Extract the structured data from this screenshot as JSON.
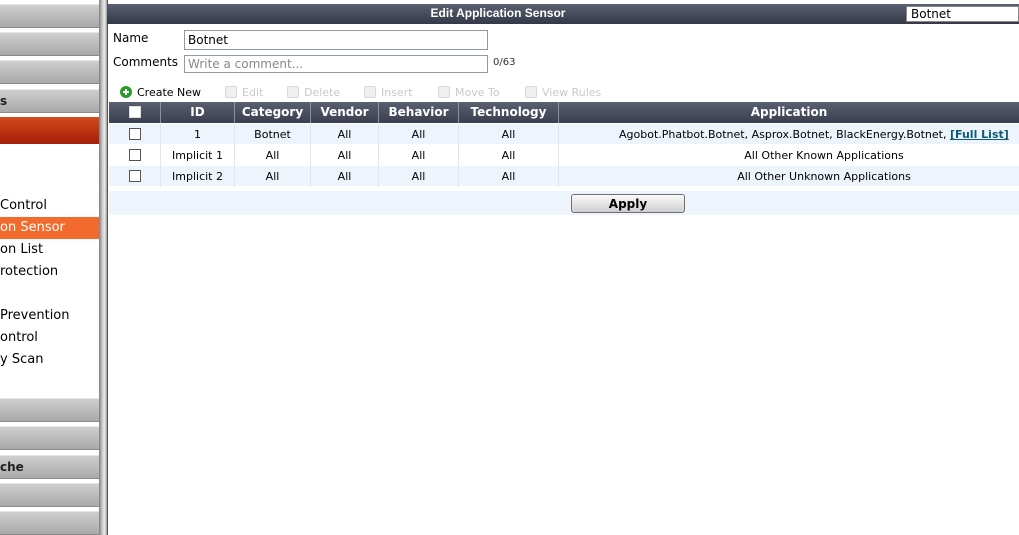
{
  "sidebar": {
    "section_label_1": "s",
    "section_label_2": "che",
    "items": [
      {
        "label": " Control",
        "selected": false
      },
      {
        "label": "on Sensor",
        "selected": true
      },
      {
        "label": "on List",
        "selected": false
      },
      {
        "label": "rotection",
        "selected": false
      },
      {
        "label": " Prevention",
        "selected": false
      },
      {
        "label": "ontrol",
        "selected": false
      },
      {
        "label": "y Scan",
        "selected": false
      }
    ]
  },
  "dialog": {
    "title": "Edit Application Sensor",
    "title_field_value": "Botnet"
  },
  "form": {
    "name_label": "Name",
    "name_value": "Botnet",
    "comments_label": "Comments",
    "comments_placeholder": "Write a comment...",
    "counter": "0/63"
  },
  "toolbar": {
    "create_new": "Create New",
    "edit": "Edit",
    "delete": "Delete",
    "insert": "Insert",
    "move_to": "Move To",
    "view_rules": "View Rules"
  },
  "table": {
    "headers": {
      "id": "ID",
      "category": "Category",
      "vendor": "Vendor",
      "behavior": "Behavior",
      "technology": "Technology",
      "application": "Application"
    },
    "rows": [
      {
        "id": "1",
        "category": "Botnet",
        "vendor": "All",
        "behavior": "All",
        "technology": "All",
        "application": "Agobot.Phatbot.Botnet, Asprox.Botnet, BlackEnergy.Botnet, ",
        "link": "[Full List]"
      },
      {
        "id": "Implicit 1",
        "category": "All",
        "vendor": "All",
        "behavior": "All",
        "technology": "All",
        "application": "All Other Known Applications"
      },
      {
        "id": "Implicit 2",
        "category": "All",
        "vendor": "All",
        "behavior": "All",
        "technology": "All",
        "application": "All Other Unknown Applications"
      }
    ]
  },
  "actions": {
    "apply": "Apply"
  },
  "colors": {
    "title_bar": "#3f4456",
    "sidebar_selected": "#f26a2c",
    "sidebar_red_bar": "#c0320f",
    "link": "#0b5a78"
  }
}
